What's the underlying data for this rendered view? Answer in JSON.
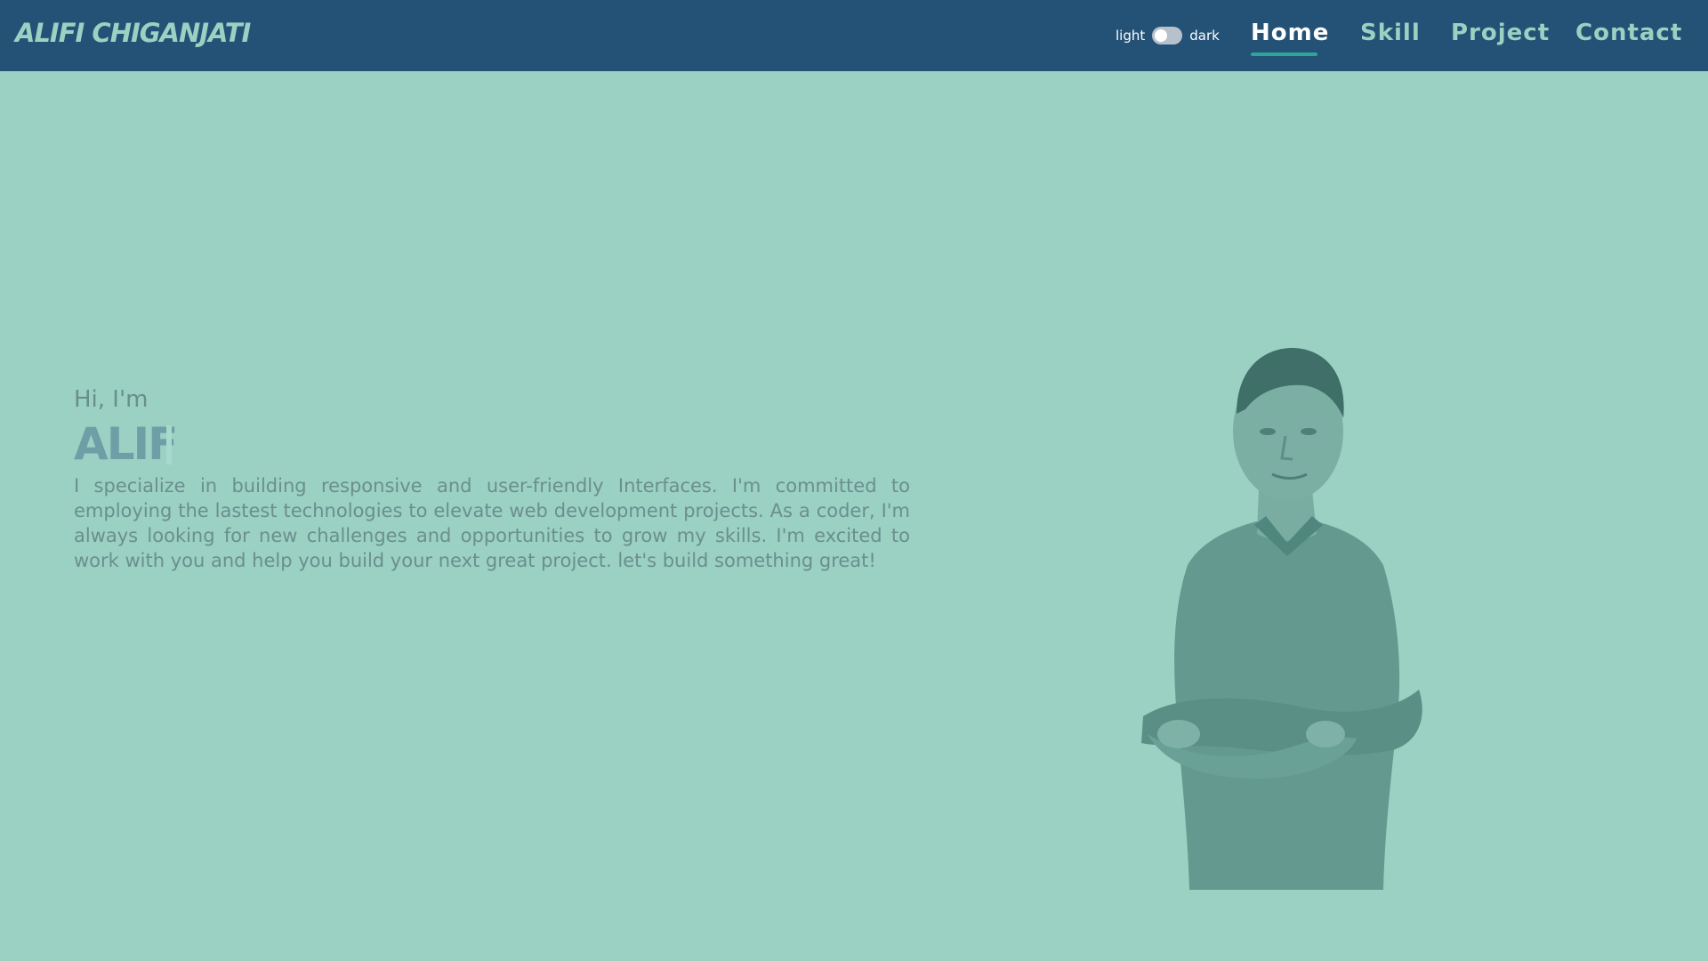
{
  "header": {
    "brand": "ALIFI CHIGANJATI",
    "theme_toggle": {
      "light_label": "light",
      "dark_label": "dark",
      "state": "light"
    },
    "nav": [
      {
        "label": "Home",
        "active": true
      },
      {
        "label": "Skill",
        "active": false
      },
      {
        "label": "Project",
        "active": false
      },
      {
        "label": "Contact",
        "active": false
      }
    ]
  },
  "hero": {
    "greeting": "Hi, I'm",
    "name": "ALIF",
    "bio": "I specialize in building responsive and user-friendly Interfaces. I'm committed to employing the lastest technologies to elevate web development projects. As a coder, I'm always looking for new challenges and opportunities to grow my skills. I'm excited to work with you and help you build your next great project. let's build something great!",
    "image": "portrait-photo"
  },
  "colors": {
    "navbar_bg": "#245276",
    "page_bg": "#9ad1c3",
    "accent": "#2ea59a",
    "nav_text": "#9ad1c3",
    "nav_active": "#ffffff"
  }
}
